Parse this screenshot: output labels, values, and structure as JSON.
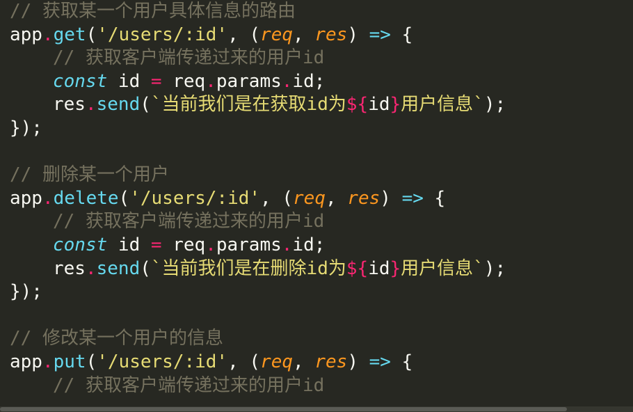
{
  "lines": [
    [
      {
        "t": "// 获取某一个用户具体信息的路由",
        "c": "cm"
      }
    ],
    [
      {
        "t": "app",
        "c": "pl"
      },
      {
        "t": ".",
        "c": "pu"
      },
      {
        "t": "get",
        "c": "fn"
      },
      {
        "t": "(",
        "c": "pl"
      },
      {
        "t": "'/users/:id'",
        "c": "st"
      },
      {
        "t": ", (",
        "c": "pl"
      },
      {
        "t": "req",
        "c": "pa"
      },
      {
        "t": ", ",
        "c": "pl"
      },
      {
        "t": "res",
        "c": "pa"
      },
      {
        "t": ") ",
        "c": "pl"
      },
      {
        "t": "=>",
        "c": "fn"
      },
      {
        "t": " {",
        "c": "pl"
      }
    ],
    [
      {
        "indent": 1
      },
      {
        "t": "// 获取客户端传递过来的用户id",
        "c": "cm"
      }
    ],
    [
      {
        "indent": 1
      },
      {
        "t": "const",
        "c": "kw"
      },
      {
        "t": " id ",
        "c": "pl"
      },
      {
        "t": "=",
        "c": "pu"
      },
      {
        "t": " req",
        "c": "pl"
      },
      {
        "t": ".",
        "c": "pu"
      },
      {
        "t": "params",
        "c": "pl"
      },
      {
        "t": ".",
        "c": "pu"
      },
      {
        "t": "id;",
        "c": "pl"
      }
    ],
    [
      {
        "indent": 1
      },
      {
        "t": "res",
        "c": "pl"
      },
      {
        "t": ".",
        "c": "pu"
      },
      {
        "t": "send",
        "c": "fn"
      },
      {
        "t": "(",
        "c": "pl"
      },
      {
        "t": "`当前我们是在获取id为",
        "c": "st"
      },
      {
        "t": "${",
        "c": "br"
      },
      {
        "t": "id",
        "c": "ir"
      },
      {
        "t": "}",
        "c": "br"
      },
      {
        "t": "用户信息`",
        "c": "st"
      },
      {
        "t": ");",
        "c": "pl"
      }
    ],
    [
      {
        "t": "});",
        "c": "pl"
      }
    ],
    [],
    [
      {
        "t": "// 删除某一个用户",
        "c": "cm"
      }
    ],
    [
      {
        "t": "app",
        "c": "pl"
      },
      {
        "t": ".",
        "c": "pu"
      },
      {
        "t": "delete",
        "c": "fn"
      },
      {
        "t": "(",
        "c": "pl"
      },
      {
        "t": "'/users/:id'",
        "c": "st"
      },
      {
        "t": ", (",
        "c": "pl"
      },
      {
        "t": "req",
        "c": "pa"
      },
      {
        "t": ", ",
        "c": "pl"
      },
      {
        "t": "res",
        "c": "pa"
      },
      {
        "t": ") ",
        "c": "pl"
      },
      {
        "t": "=>",
        "c": "fn"
      },
      {
        "t": " {",
        "c": "pl"
      }
    ],
    [
      {
        "indent": 1
      },
      {
        "t": "// 获取客户端传递过来的用户id",
        "c": "cm"
      }
    ],
    [
      {
        "indent": 1
      },
      {
        "t": "const",
        "c": "kw"
      },
      {
        "t": " id ",
        "c": "pl"
      },
      {
        "t": "=",
        "c": "pu"
      },
      {
        "t": " req",
        "c": "pl"
      },
      {
        "t": ".",
        "c": "pu"
      },
      {
        "t": "params",
        "c": "pl"
      },
      {
        "t": ".",
        "c": "pu"
      },
      {
        "t": "id;",
        "c": "pl"
      }
    ],
    [
      {
        "indent": 1
      },
      {
        "t": "res",
        "c": "pl"
      },
      {
        "t": ".",
        "c": "pu"
      },
      {
        "t": "send",
        "c": "fn"
      },
      {
        "t": "(",
        "c": "pl"
      },
      {
        "t": "`当前我们是在删除id为",
        "c": "st"
      },
      {
        "t": "${",
        "c": "br"
      },
      {
        "t": "id",
        "c": "ir"
      },
      {
        "t": "}",
        "c": "br"
      },
      {
        "t": "用户信息`",
        "c": "st"
      },
      {
        "t": ");",
        "c": "pl"
      }
    ],
    [
      {
        "t": "});",
        "c": "pl"
      }
    ],
    [],
    [
      {
        "t": "// 修改某一个用户的信息",
        "c": "cm"
      }
    ],
    [
      {
        "t": "app",
        "c": "pl"
      },
      {
        "t": ".",
        "c": "pu"
      },
      {
        "t": "put",
        "c": "fn"
      },
      {
        "t": "(",
        "c": "pl"
      },
      {
        "t": "'/users/:id'",
        "c": "st"
      },
      {
        "t": ", (",
        "c": "pl"
      },
      {
        "t": "req",
        "c": "pa"
      },
      {
        "t": ", ",
        "c": "pl"
      },
      {
        "t": "res",
        "c": "pa"
      },
      {
        "t": ") ",
        "c": "pl"
      },
      {
        "t": "=>",
        "c": "fn"
      },
      {
        "t": " {",
        "c": "pl"
      }
    ],
    [
      {
        "indent": 1
      },
      {
        "t": "// 获取客户端传递过来的用户id",
        "c": "cm"
      }
    ]
  ],
  "theme": {
    "background": "#272822",
    "comment": "#75715e",
    "plain": "#f8f8f2",
    "function": "#66d9ef",
    "punctuation": "#f92672",
    "string": "#e6db74",
    "parameter": "#fd971f"
  }
}
